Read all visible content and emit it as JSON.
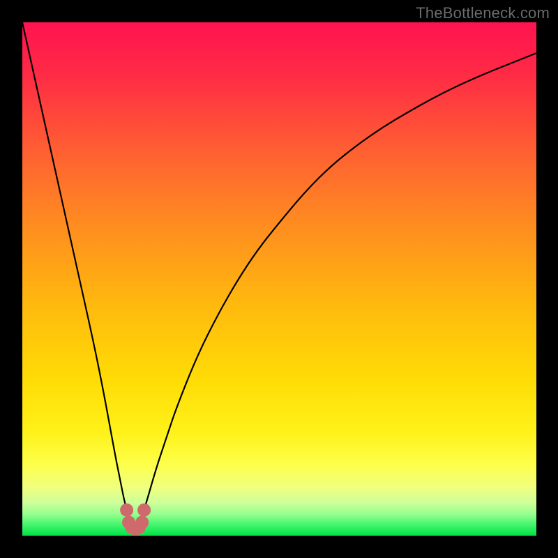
{
  "watermark": "TheBottleneck.com",
  "colors": {
    "frame": "#000000",
    "curve": "#000000",
    "marker_fill": "#cf6a6c",
    "marker_stroke": "#cf6a6c",
    "green_band": "#00e246"
  },
  "chart_data": {
    "type": "line",
    "title": "",
    "xlabel": "",
    "ylabel": "",
    "xlim": [
      0,
      100
    ],
    "ylim": [
      0,
      100
    ],
    "grid": false,
    "legend": false,
    "series": [
      {
        "name": "bottleneck-curve",
        "x": [
          0,
          2,
          4,
          6,
          8,
          10,
          12,
          14,
          16,
          18,
          19,
          20,
          21,
          22,
          23,
          24,
          26,
          28,
          30,
          34,
          38,
          42,
          46,
          50,
          55,
          60,
          65,
          70,
          75,
          80,
          85,
          90,
          95,
          100
        ],
        "y": [
          100,
          91,
          82,
          73,
          64,
          55,
          46,
          37,
          27,
          16,
          11,
          6,
          3,
          1.5,
          3,
          6,
          13,
          19,
          25,
          35,
          43,
          50,
          56,
          61,
          67,
          72,
          76,
          79.5,
          82.5,
          85.3,
          87.8,
          90,
          92,
          94
        ]
      }
    ],
    "markers": {
      "name": "trough-markers",
      "points": [
        {
          "x": 20.3,
          "y": 5.0
        },
        {
          "x": 20.7,
          "y": 2.6
        },
        {
          "x": 21.3,
          "y": 1.6
        },
        {
          "x": 22.0,
          "y": 1.3
        },
        {
          "x": 22.7,
          "y": 1.6
        },
        {
          "x": 23.3,
          "y": 2.6
        },
        {
          "x": 23.7,
          "y": 5.0
        }
      ]
    },
    "background_gradient": {
      "orientation": "top-to-bottom",
      "stops": [
        {
          "offset": 0.0,
          "color": "#ff1350"
        },
        {
          "offset": 0.1,
          "color": "#ff2a45"
        },
        {
          "offset": 0.25,
          "color": "#ff5f32"
        },
        {
          "offset": 0.4,
          "color": "#ff8e1f"
        },
        {
          "offset": 0.55,
          "color": "#ffb90e"
        },
        {
          "offset": 0.7,
          "color": "#ffdd06"
        },
        {
          "offset": 0.8,
          "color": "#fff21a"
        },
        {
          "offset": 0.86,
          "color": "#fdff4a"
        },
        {
          "offset": 0.905,
          "color": "#f1ff7d"
        },
        {
          "offset": 0.935,
          "color": "#cfff9a"
        },
        {
          "offset": 0.958,
          "color": "#96ff8f"
        },
        {
          "offset": 0.978,
          "color": "#46f66e"
        },
        {
          "offset": 1.0,
          "color": "#00e246"
        }
      ]
    }
  }
}
